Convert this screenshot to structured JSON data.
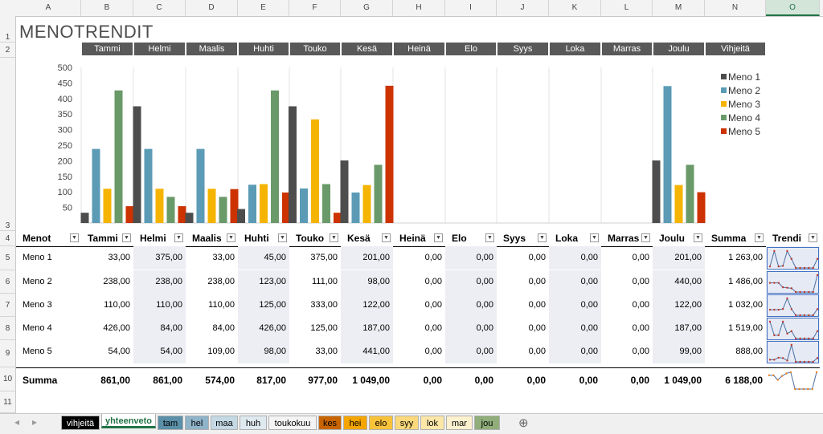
{
  "columns": [
    "A",
    "B",
    "C",
    "D",
    "E",
    "F",
    "G",
    "H",
    "I",
    "J",
    "K",
    "L",
    "M",
    "N",
    "O"
  ],
  "rows": [
    "1",
    "2",
    "3",
    "4",
    "5",
    "6",
    "7",
    "8",
    "9",
    "10",
    "11"
  ],
  "title": "MENOTRENDIT",
  "month_headers": [
    "Tammi",
    "Helmi",
    "Maalis",
    "Huhti",
    "Touko",
    "Kesä",
    "Heinä",
    "Elo",
    "Syys",
    "Loka",
    "Marras",
    "Joulu",
    "Vihjeitä"
  ],
  "table": {
    "headers": [
      "Menot",
      "Tammi",
      "Helmi",
      "Maalis",
      "Huhti",
      "Touko",
      "Kesä",
      "Heinä",
      "Elo",
      "Syys",
      "Loka",
      "Marras",
      "Joulu",
      "Summa",
      "Trendi"
    ],
    "rows": [
      {
        "label": "Meno 1",
        "values": [
          "33,00",
          "375,00",
          "33,00",
          "45,00",
          "375,00",
          "201,00",
          "0,00",
          "0,00",
          "0,00",
          "0,00",
          "0,00",
          "201,00"
        ],
        "sum": "1 263,00"
      },
      {
        "label": "Meno 2",
        "values": [
          "238,00",
          "238,00",
          "238,00",
          "123,00",
          "111,00",
          "98,00",
          "0,00",
          "0,00",
          "0,00",
          "0,00",
          "0,00",
          "440,00"
        ],
        "sum": "1 486,00"
      },
      {
        "label": "Meno 3",
        "values": [
          "110,00",
          "110,00",
          "110,00",
          "125,00",
          "333,00",
          "122,00",
          "0,00",
          "0,00",
          "0,00",
          "0,00",
          "0,00",
          "122,00"
        ],
        "sum": "1 032,00"
      },
      {
        "label": "Meno 4",
        "values": [
          "426,00",
          "84,00",
          "84,00",
          "426,00",
          "125,00",
          "187,00",
          "0,00",
          "0,00",
          "0,00",
          "0,00",
          "0,00",
          "187,00"
        ],
        "sum": "1 519,00"
      },
      {
        "label": "Meno 5",
        "values": [
          "54,00",
          "54,00",
          "109,00",
          "98,00",
          "33,00",
          "441,00",
          "0,00",
          "0,00",
          "0,00",
          "0,00",
          "0,00",
          "99,00"
        ],
        "sum": "888,00"
      }
    ],
    "total": {
      "label": "Summa",
      "values": [
        "861,00",
        "861,00",
        "574,00",
        "817,00",
        "977,00",
        "1 049,00",
        "0,00",
        "0,00",
        "0,00",
        "0,00",
        "0,00",
        "1 049,00"
      ],
      "sum": "6 188,00"
    }
  },
  "chart_data": {
    "type": "bar",
    "categories": [
      "Tammi",
      "Helmi",
      "Maalis",
      "Huhti",
      "Touko",
      "Kesä",
      "Heinä",
      "Elo",
      "Syys",
      "Loka",
      "Marras",
      "Joulu"
    ],
    "series": [
      {
        "name": "Meno 1",
        "color": "#4d4d4d",
        "values": [
          33,
          375,
          33,
          45,
          375,
          201,
          0,
          0,
          0,
          0,
          0,
          201
        ]
      },
      {
        "name": "Meno 2",
        "color": "#5b9bb5",
        "values": [
          238,
          238,
          238,
          123,
          111,
          98,
          0,
          0,
          0,
          0,
          0,
          440
        ]
      },
      {
        "name": "Meno 3",
        "color": "#f5b400",
        "values": [
          110,
          110,
          110,
          125,
          333,
          122,
          0,
          0,
          0,
          0,
          0,
          122
        ]
      },
      {
        "name": "Meno 4",
        "color": "#6a9a6a",
        "values": [
          426,
          84,
          84,
          426,
          125,
          187,
          0,
          0,
          0,
          0,
          0,
          187
        ]
      },
      {
        "name": "Meno 5",
        "color": "#cc3300",
        "values": [
          54,
          54,
          109,
          98,
          33,
          441,
          0,
          0,
          0,
          0,
          0,
          99
        ]
      }
    ],
    "yticks": [
      "500",
      "450",
      "400",
      "350",
      "300",
      "250",
      "200",
      "150",
      "100",
      "50"
    ],
    "ylim": [
      0,
      500
    ],
    "legend": "right"
  },
  "sheet_tabs": [
    {
      "label": "vihjeitä",
      "bg": "#000000",
      "fg": "#ffffff"
    },
    {
      "label": "yhteenveto",
      "bg": "#ffffff",
      "fg": "#217346",
      "active": true
    },
    {
      "label": "tam",
      "bg": "#5b8fa8",
      "fg": "#000000"
    },
    {
      "label": "hel",
      "bg": "#8fb3c8",
      "fg": "#000000"
    },
    {
      "label": "maa",
      "bg": "#c4d9e4",
      "fg": "#000000"
    },
    {
      "label": "huh",
      "bg": "#dfe9f0",
      "fg": "#000000"
    },
    {
      "label": "toukokuu",
      "bg": "#f4f4f4",
      "fg": "#000000"
    },
    {
      "label": "kes",
      "bg": "#c86400",
      "fg": "#000000"
    },
    {
      "label": "hei",
      "bg": "#f5a500",
      "fg": "#000000"
    },
    {
      "label": "elo",
      "bg": "#f8c23a",
      "fg": "#000000"
    },
    {
      "label": "syy",
      "bg": "#fbd97a",
      "fg": "#000000"
    },
    {
      "label": "lok",
      "bg": "#fce7a8",
      "fg": "#000000"
    },
    {
      "label": "mar",
      "bg": "#fdf1cf",
      "fg": "#000000"
    },
    {
      "label": "jou",
      "bg": "#8fae7a",
      "fg": "#000000"
    }
  ],
  "add_sheet": "⊕",
  "nav_prev": "◂",
  "nav_next": "▸",
  "colors": {
    "accent": "#217346",
    "header_dark": "#595959",
    "band": "#eceef3"
  }
}
